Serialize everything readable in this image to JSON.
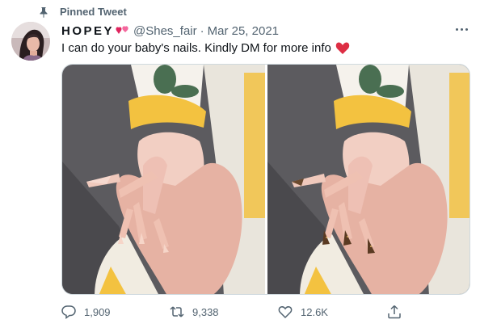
{
  "social_context": {
    "label": "Pinned Tweet",
    "icon": "pin-icon"
  },
  "author": {
    "display_name": "HOPEY",
    "name_emoji": "two-hearts-emoji",
    "handle": "@Shes_fair",
    "separator": "·",
    "date": "Mar 25, 2021"
  },
  "tweet": {
    "text": "I can do your baby's nails. Kindly DM for more info",
    "trailing_emoji": "red-heart-emoji"
  },
  "media": {
    "photos": [
      {
        "description_icon": "photo-nails-natural"
      },
      {
        "description_icon": "photo-nails-glitter"
      }
    ]
  },
  "actions": {
    "reply": {
      "icon": "reply-icon",
      "count": "1,909"
    },
    "retweet": {
      "icon": "retweet-icon",
      "count": "9,338"
    },
    "like": {
      "icon": "like-icon",
      "count": "12.6K"
    },
    "share": {
      "icon": "share-icon"
    }
  },
  "colors": {
    "text_primary": "#0f1419",
    "text_secondary": "#536471",
    "border": "#cfd9de",
    "heart": "#f91880"
  }
}
